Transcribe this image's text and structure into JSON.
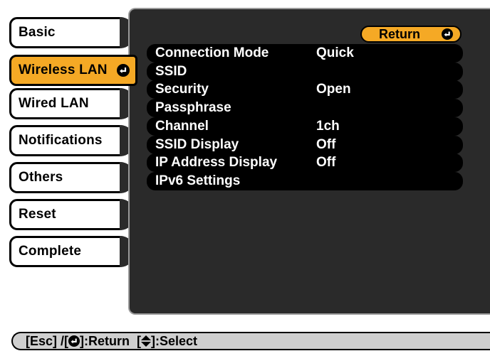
{
  "tabs": [
    {
      "label": "Basic",
      "active": false
    },
    {
      "label": "Wireless LAN",
      "active": true
    },
    {
      "label": "Wired LAN",
      "active": false
    },
    {
      "label": "Notifications",
      "active": false
    },
    {
      "label": "Others",
      "active": false
    },
    {
      "label": "Reset",
      "active": false
    },
    {
      "label": "Complete",
      "active": false
    }
  ],
  "panel": {
    "return_label": "Return",
    "settings": [
      {
        "name": "Connection Mode",
        "value": "Quick"
      },
      {
        "name": "SSID",
        "value": ""
      },
      {
        "name": "Security",
        "value": "Open"
      },
      {
        "name": "Passphrase",
        "value": ""
      },
      {
        "name": "Channel",
        "value": "1ch"
      },
      {
        "name": "SSID Display",
        "value": "Off"
      },
      {
        "name": "IP Address Display",
        "value": "Off"
      },
      {
        "name": "IPv6 Settings",
        "value": ""
      }
    ]
  },
  "help": {
    "esc": "[Esc] /[",
    "return_text": "]:Return  [",
    "select_text": "]:Select"
  },
  "icons": {
    "enter": "enter-icon",
    "updown": "up-down-arrow-icon"
  },
  "colors": {
    "accent": "#f5a925",
    "panel_bg": "#2a2a2a",
    "row_bg": "#000000",
    "help_bg": "#cfcfcf"
  }
}
